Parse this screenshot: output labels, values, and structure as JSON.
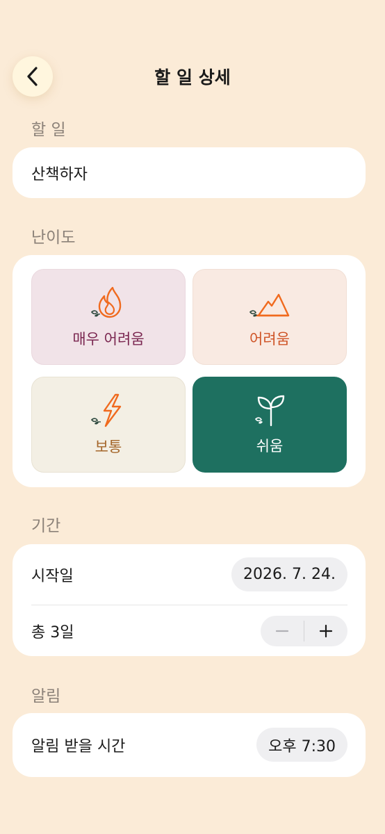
{
  "header": {
    "title": "할 일 상세"
  },
  "sections": {
    "task": "할 일",
    "difficulty": "난이도",
    "period": "기간",
    "alarm": "알림"
  },
  "task": {
    "value": "산책하자"
  },
  "difficulty": {
    "selected": "쉬움",
    "options": [
      {
        "label": "매우 어려움",
        "icon": "fire-icon",
        "color": "#7A2650",
        "bg": "#F1E3E8"
      },
      {
        "label": "어려움",
        "icon": "mountain-icon",
        "color": "#CF5427",
        "bg": "#F9EAE2"
      },
      {
        "label": "보통",
        "icon": "lightning-icon",
        "color": "#A4662A",
        "bg": "#F3EFE4"
      },
      {
        "label": "쉬움",
        "icon": "sprout-icon",
        "color": "#FFFFFF",
        "bg": "#1E7060"
      }
    ]
  },
  "period": {
    "start_label": "시작일",
    "start_value": "2026. 7. 24.",
    "total_label": "총 3일"
  },
  "alarm": {
    "label": "알림 받을 시간",
    "value": "오후 7:30"
  },
  "colors": {
    "background": "#FBEBD7",
    "accent": "#1E7060",
    "orange": "#F06A1E"
  }
}
